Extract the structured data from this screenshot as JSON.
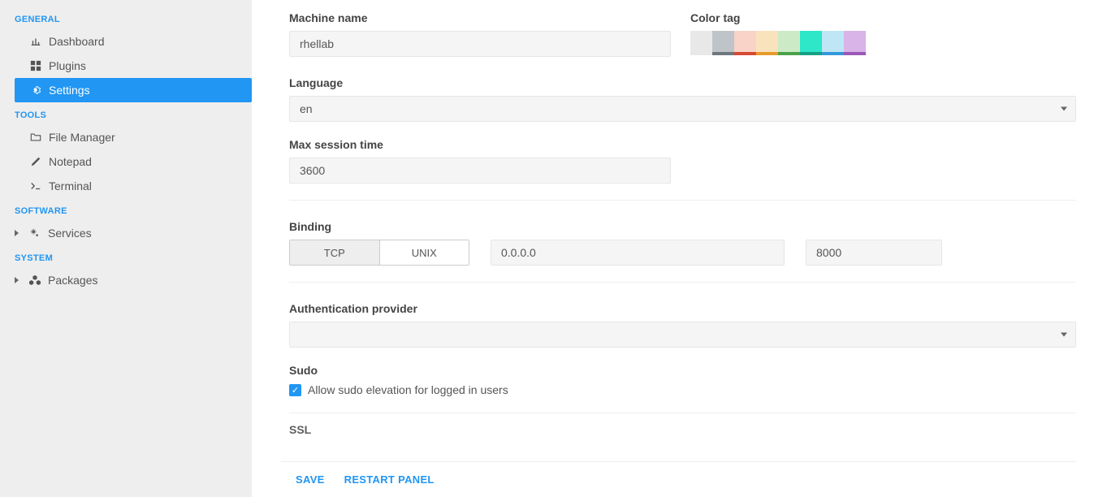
{
  "sidebar": {
    "sections": [
      {
        "title": "GENERAL",
        "items": [
          {
            "key": "dashboard",
            "label": "Dashboard",
            "icon": "bar-chart-icon",
            "active": false
          },
          {
            "key": "plugins",
            "label": "Plugins",
            "icon": "grid-icon",
            "active": false
          },
          {
            "key": "settings",
            "label": "Settings",
            "icon": "gear-icon",
            "active": true
          }
        ]
      },
      {
        "title": "TOOLS",
        "items": [
          {
            "key": "file-manager",
            "label": "File Manager",
            "icon": "folder-icon",
            "active": false
          },
          {
            "key": "notepad",
            "label": "Notepad",
            "icon": "pencil-icon",
            "active": false
          },
          {
            "key": "terminal",
            "label": "Terminal",
            "icon": "terminal-icon",
            "active": false
          }
        ]
      },
      {
        "title": "SOFTWARE",
        "items": [
          {
            "key": "services",
            "label": "Services",
            "icon": "cogs-icon",
            "active": false,
            "expandable": true
          }
        ]
      },
      {
        "title": "SYSTEM",
        "items": [
          {
            "key": "packages",
            "label": "Packages",
            "icon": "cubes-icon",
            "active": false,
            "expandable": true
          }
        ]
      }
    ]
  },
  "form": {
    "machine_name": {
      "label": "Machine name",
      "value": "rhellab"
    },
    "color_tag": {
      "label": "Color tag",
      "swatches": [
        {
          "top": "#e8e8e8",
          "foot": "#e8e8e8"
        },
        {
          "top": "#bfc4c8",
          "foot": "#6e777e"
        },
        {
          "top": "#f9d3c8",
          "foot": "#d64a34"
        },
        {
          "top": "#f9e3bd",
          "foot": "#e89b2b"
        },
        {
          "top": "#cdeac6",
          "foot": "#4aa24a"
        },
        {
          "top": "#2ee6c8",
          "foot": "#16a085"
        },
        {
          "top": "#bfe6f4",
          "foot": "#3498db"
        },
        {
          "top": "#d8b4e8",
          "foot": "#9b59b6"
        }
      ]
    },
    "language": {
      "label": "Language",
      "value": "en"
    },
    "max_session": {
      "label": "Max session time",
      "value": "3600"
    },
    "binding": {
      "label": "Binding",
      "seg_a": "TCP",
      "seg_b": "UNIX",
      "active": "TCP",
      "host": "0.0.0.0",
      "port": "8000"
    },
    "auth": {
      "label": "Authentication provider",
      "value": ""
    },
    "sudo": {
      "label": "Sudo",
      "checkbox_label": "Allow sudo elevation for logged in users",
      "checked": true
    },
    "ssl": {
      "label": "SSL"
    }
  },
  "footer": {
    "save": "SAVE",
    "restart": "RESTART PANEL"
  }
}
